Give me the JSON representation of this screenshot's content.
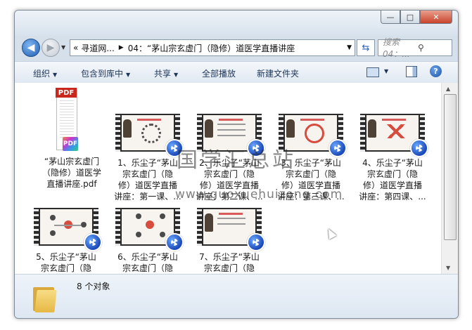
{
  "address": {
    "crumbs": [
      "寻道网...",
      "04：“茅山宗玄虚门（隐修）道医学直播讲座"
    ],
    "search_placeholder": "搜索 04：..."
  },
  "window_buttons": {
    "minimize": "—",
    "maximize": "□",
    "close": "✕"
  },
  "toolbar": {
    "organize": "组织",
    "include": "包含到库中",
    "share": "共享",
    "play_all": "全部播放",
    "new_folder": "新建文件夹"
  },
  "files": [
    {
      "type": "pdf",
      "lines": [
        "“茅山宗玄虚门",
        "（隐修）道医学",
        "直播讲座.pdf"
      ]
    },
    {
      "type": "video",
      "lines": [
        "1、乐尘子“茅山",
        "宗玄虚门（隐",
        "修）道医学直播",
        "讲座：第一课、..."
      ]
    },
    {
      "type": "video",
      "lines": [
        "2、乐尘子“茅山",
        "宗玄虚门（隐",
        "修）道医学直播",
        "讲座：第二课、..."
      ]
    },
    {
      "type": "video",
      "lines": [
        "3、乐尘子“茅山",
        "宗玄虚门（隐",
        "修）道医学直播",
        "讲座：第三课、..."
      ]
    },
    {
      "type": "video",
      "lines": [
        "4、乐尘子“茅山",
        "宗玄虚门（隐",
        "修）道医学直播",
        "讲座：第四课、..."
      ]
    },
    {
      "type": "video",
      "lines": [
        "5、乐尘子“茅山",
        "宗玄虚门（隐"
      ]
    },
    {
      "type": "video",
      "lines": [
        "6、乐尘子“茅山",
        "宗玄虚门（隐"
      ]
    },
    {
      "type": "video",
      "lines": [
        "7、乐尘子“茅山",
        "宗玄虚门（隐"
      ]
    }
  ],
  "watermark": {
    "line1": "国学汇总站",
    "line2": "www.guoxuehuizong.com"
  },
  "status": {
    "count": "8 个对象"
  },
  "icons": {
    "back": "back-arrow-icon",
    "forward": "forward-arrow-icon",
    "refresh": "refresh-icon",
    "search": "search-icon",
    "help": "help-icon"
  }
}
